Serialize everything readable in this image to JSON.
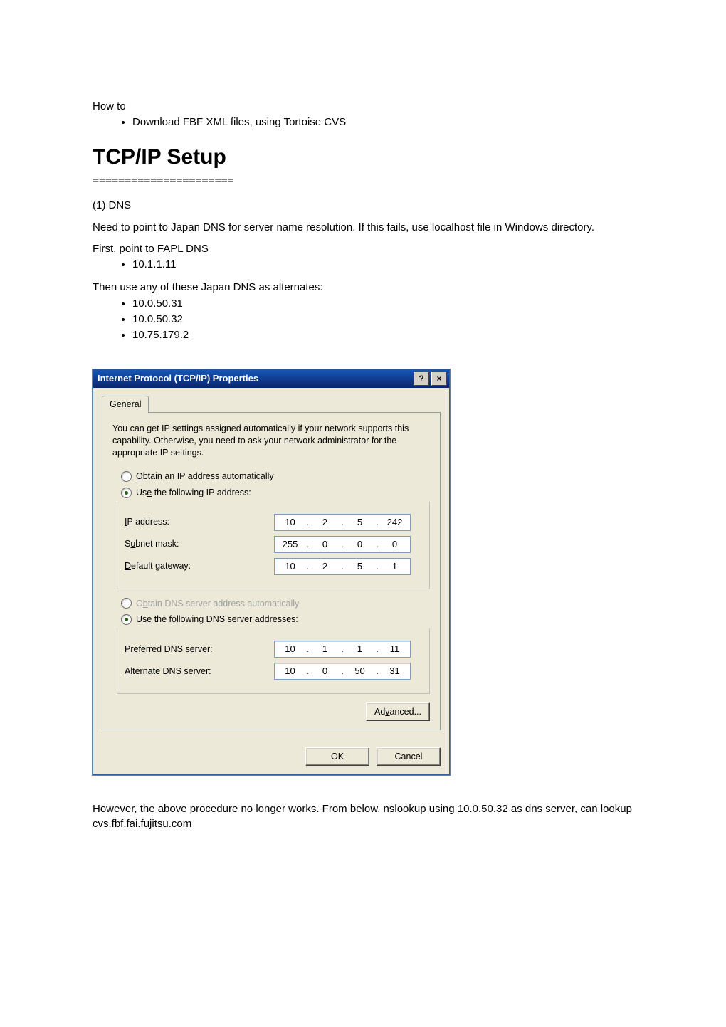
{
  "doc": {
    "howto": "How to",
    "howto_items": [
      "Download FBF XML files, using Tortoise CVS"
    ],
    "section_title": "TCP/IP Setup",
    "divider": "======================",
    "step1": "(1) DNS",
    "need_para": "Need to point to Japan DNS for server name resolution. If this fails, use localhost file in Windows directory.",
    "first_line": "First, point to FAPL DNS",
    "first_items": [
      "10.1.1.11"
    ],
    "then_line": "Then use any of these Japan DNS as alternates:",
    "then_items": [
      "10.0.50.31",
      "10.0.50.32",
      "10.75.179.2"
    ],
    "footer": "However, the above procedure no longer works. From below, nslookup using 10.0.50.32 as dns server, can lookup cvs.fbf.fai.fujitsu.com"
  },
  "dlg": {
    "title": "Internet Protocol (TCP/IP) Properties",
    "help": "?",
    "close": "×",
    "tab": "General",
    "intro": "You can get IP settings assigned automatically if your network supports this capability. Otherwise, you need to ask your network administrator for the appropriate IP settings.",
    "opt_obtain_ip_pre": "O",
    "opt_obtain_ip_rest": "btain an IP address automatically",
    "opt_use_ip_pre": "Us",
    "opt_use_ip_mid": "e",
    "opt_use_ip_rest": " the following IP address:",
    "ip_label_pre": "I",
    "ip_label_rest": "P address:",
    "subnet_pre": "S",
    "subnet_mid": "u",
    "subnet_rest": "bnet mask:",
    "gw_pre": "D",
    "gw_rest": "efault gateway:",
    "opt_obtain_dns_pre": "O",
    "opt_obtain_dns_mid": "b",
    "opt_obtain_dns_rest": "tain DNS server address automatically",
    "opt_use_dns_pre": "Us",
    "opt_use_dns_mid": "e",
    "opt_use_dns_rest": " the following DNS server addresses:",
    "pref_pre": "P",
    "pref_rest": "referred DNS server:",
    "alt_pre": "A",
    "alt_rest": "lternate DNS server:",
    "ip": {
      "a": "10",
      "b": "2",
      "c": "5",
      "d": "242"
    },
    "mask": {
      "a": "255",
      "b": "0",
      "c": "0",
      "d": "0"
    },
    "gw": {
      "a": "10",
      "b": "2",
      "c": "5",
      "d": "1"
    },
    "pdns": {
      "a": "10",
      "b": "1",
      "c": "1",
      "d": "11"
    },
    "adns": {
      "a": "10",
      "b": "0",
      "c": "50",
      "d": "31"
    },
    "adv_pre": "Ad",
    "adv_mid": "v",
    "adv_rest": "anced...",
    "ok": "OK",
    "cancel": "Cancel"
  }
}
